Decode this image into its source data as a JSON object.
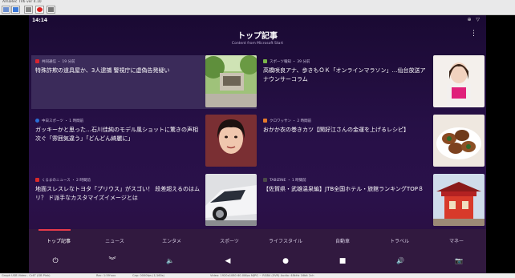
{
  "window": {
    "title": "AmaRec TV6 ver 4.10"
  },
  "status": {
    "time": "14:14",
    "icons": "⊕ ▽"
  },
  "header": {
    "title": "トップ記事",
    "subtitle": "Content from Microsoft Start",
    "menu": "⋮"
  },
  "articles": [
    {
      "source": "共同通信 ・ 19 分前",
      "title": "特殊詐欺の道具屋か、3人逮捕 警視庁に虚偽告発疑い",
      "source_color": "#d8242f"
    },
    {
      "source": "スポーツ報知 ・ 39 分前",
      "title": "高橋咲良アナ、歩きもＯＫ「オンラインマラソン」…仙台放送アナウンサーコラム",
      "source_color": "#7ab648"
    },
    {
      "source": "中日スポーツ ・ 1 時間前",
      "title": "ガッキーかと思った…石川佳純のモデル風ショットに驚きの声相次ぐ「雰囲気違う」「どんどん綺麗に」",
      "source_color": "#2a6fd6"
    },
    {
      "source": "クロワッサン ・ 2 時間前",
      "title": "おかか衣の巻きカツ【関好江さんの金運を上げるレシピ】",
      "source_color": "#e67a2a"
    },
    {
      "source": "くるまのニュース ・ 2 時間前",
      "title": "地面スレスレなトヨタ「プリウス」がスゴい！ 段差超えるのはムリ？ ド派手なカスタマイズイメージとは",
      "source_color": "#d82a2a"
    },
    {
      "source": "TABIZINE ・ 1 時間前",
      "title": "【佐賀県・武雄温泉編】JTB全国ホテル・旅館ランキングTOP８",
      "source_color": "#4a4a4a"
    }
  ],
  "tabs": [
    "トップ記事",
    "ニュース",
    "エンタメ",
    "スポーツ",
    "ライフスタイル",
    "自動車",
    "トラベル",
    "マネー"
  ],
  "active_tab": "トップ記事",
  "system_buttons": [
    {
      "name": "power",
      "glyph": "⏻"
    },
    {
      "name": "collapse",
      "glyph": "︾"
    },
    {
      "name": "volume-down",
      "glyph": "🔈"
    },
    {
      "name": "back",
      "glyph": "◀"
    },
    {
      "name": "home",
      "glyph": "●"
    },
    {
      "name": "recents",
      "glyph": "■"
    },
    {
      "name": "volume-up",
      "glyph": "🔊"
    },
    {
      "name": "screenshot",
      "glyph": "📷"
    }
  ],
  "statusline": {
    "device": "Graph USB Video - Cr4T (GB Pink)",
    "rec": "Rec: 1:59'xxx",
    "cap": "Cap: 0000fps (1/160s)",
    "video": "Video: 1920x1080 60.00fps MJPG ~ RGB4 (SVR)  Audio: 48kHz 16bit 2ch"
  }
}
